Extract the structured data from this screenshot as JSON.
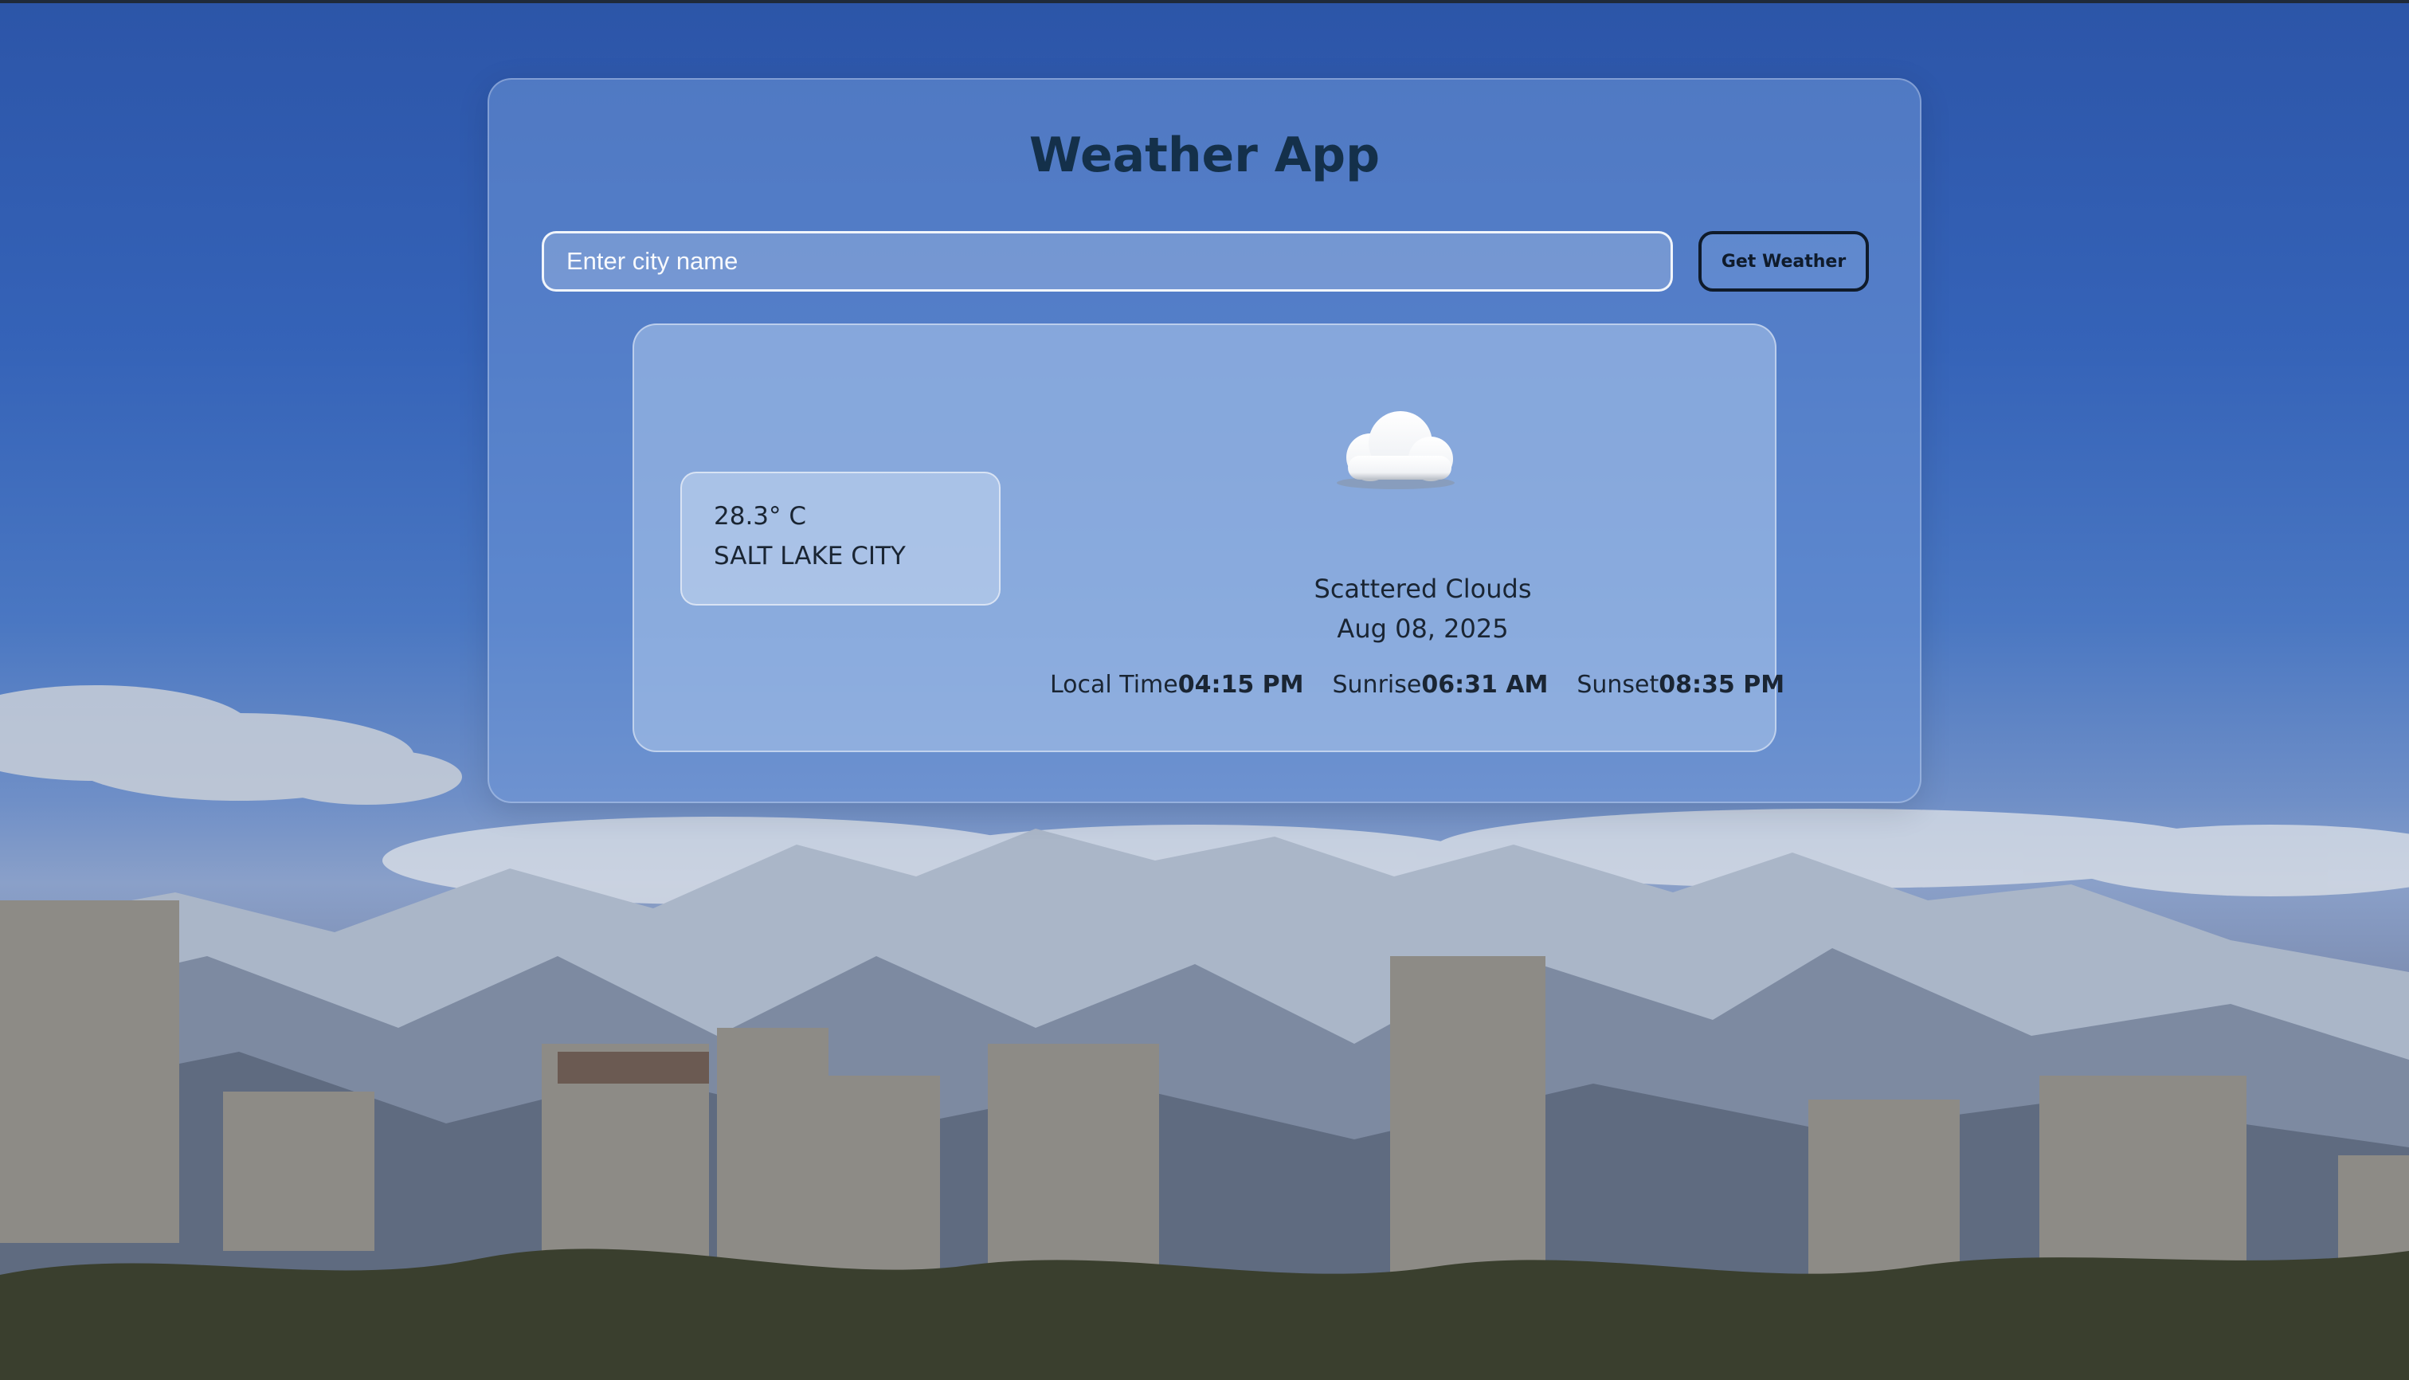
{
  "app": {
    "title": "Weather App"
  },
  "search": {
    "placeholder": "Enter city name",
    "button_label": "Get Weather"
  },
  "weather": {
    "temperature": "28.3° C",
    "city": "SALT LAKE CITY",
    "icon": "cloud-icon",
    "condition": "Scattered Clouds",
    "date": "Aug 08, 2025",
    "local_time_label": "Local Time",
    "local_time_value": "04:15 PM",
    "sunrise_label": "Sunrise",
    "sunrise_value": "06:31 AM",
    "sunset_label": "Sunset",
    "sunset_value": "08:35 PM"
  },
  "colors": {
    "title": "#14304a",
    "text": "#1a2533",
    "button_border": "#0f1b2b"
  }
}
